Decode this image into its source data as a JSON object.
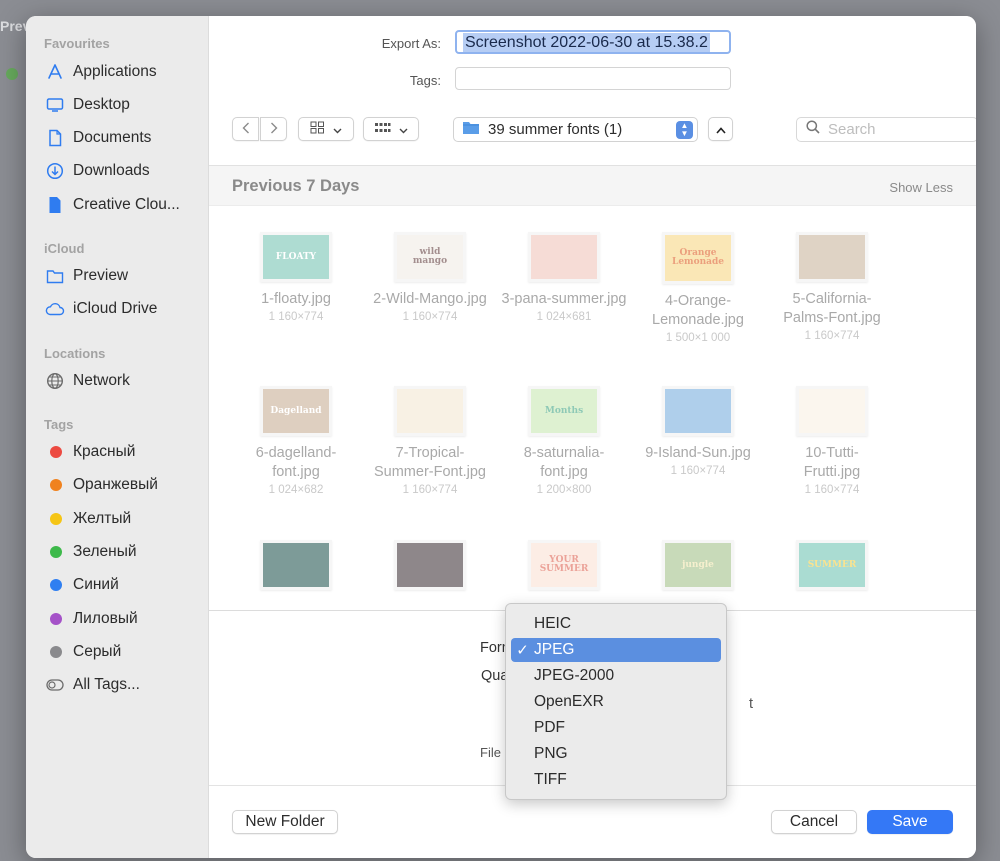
{
  "background": {
    "window_title": "Prev"
  },
  "sidebar": {
    "sections": [
      {
        "heading": "Favourites",
        "items": [
          {
            "label": "Applications",
            "icon": "applications-icon"
          },
          {
            "label": "Desktop",
            "icon": "desktop-icon"
          },
          {
            "label": "Documents",
            "icon": "document-icon"
          },
          {
            "label": "Downloads",
            "icon": "download-icon"
          },
          {
            "label": "Creative Clou...",
            "icon": "file-icon"
          }
        ]
      },
      {
        "heading": "iCloud",
        "items": [
          {
            "label": "Preview",
            "icon": "folder-icon"
          },
          {
            "label": "iCloud Drive",
            "icon": "cloud-icon"
          }
        ]
      },
      {
        "heading": "Locations",
        "items": [
          {
            "label": "Network",
            "icon": "globe-icon"
          }
        ]
      },
      {
        "heading": "Tags",
        "items": [
          {
            "label": "Красный",
            "color": "#ec4a41"
          },
          {
            "label": "Оранжевый",
            "color": "#f0821e"
          },
          {
            "label": "Желтый",
            "color": "#f5c515"
          },
          {
            "label": "Зеленый",
            "color": "#3db94a"
          },
          {
            "label": "Синий",
            "color": "#2f7ff1"
          },
          {
            "label": "Лиловый",
            "color": "#a552c8"
          },
          {
            "label": "Серый",
            "color": "#8a8a8d"
          },
          {
            "label": "All Tags...",
            "icon": "all-tags-icon"
          }
        ]
      }
    ]
  },
  "form": {
    "export_label": "Export As:",
    "export_value": "Screenshot 2022-06-30 at 15.38.2",
    "tags_label": "Tags:",
    "tags_value": ""
  },
  "toolbar": {
    "location": "39 summer fonts (1)",
    "search_placeholder": "Search"
  },
  "browser": {
    "section_title": "Previous 7 Days",
    "show_less": "Show Less",
    "files": [
      {
        "name": "1-floaty.jpg",
        "dims": "1 160×774",
        "bg": "#7ec8b8",
        "fg": "#ffffff",
        "text": "FLOATY"
      },
      {
        "name": "2-Wild-Mango.jpg",
        "dims": "1 160×774",
        "bg": "#f1ece6",
        "fg": "#6b4a4a",
        "text": "wild mango"
      },
      {
        "name": "3-pana-summer.jpg",
        "dims": "1 024×681",
        "bg": "#f2c8bd",
        "fg": "#ffffff",
        "text": ""
      },
      {
        "name": "4-Orange-Lemonade.jpg",
        "dims": "1 500×1 000",
        "bg": "#f7d98a",
        "fg": "#e0662e",
        "text": "Orange Lemonade"
      },
      {
        "name": "5-California-Palms-Font.jpg",
        "dims": "1 160×774",
        "bg": "#cdb9a3",
        "fg": "#5d4a3a",
        "text": ""
      },
      {
        "name": "6-dagelland-font.jpg",
        "dims": "1 024×682",
        "bg": "#cbb29a",
        "fg": "#ffffff",
        "text": "Dagelland"
      },
      {
        "name": "7-Tropical-Summer-Font.jpg",
        "dims": "1 160×774",
        "bg": "#f4e9d4",
        "fg": "#3d8f8f",
        "text": ""
      },
      {
        "name": "8-saturnalia-font.jpg",
        "dims": "1 200×800",
        "bg": "#cbe9b5",
        "fg": "#4aa98a",
        "text": "Months"
      },
      {
        "name": "9-Island-Sun.jpg",
        "dims": "1 160×774",
        "bg": "#7fb3e0",
        "fg": "#f5c04b",
        "text": ""
      },
      {
        "name": "10-Tutti-Frutti.jpg",
        "dims": "1 160×774",
        "bg": "#f9f1e4",
        "fg": "#e38a5c",
        "text": ""
      },
      {
        "name": "",
        "dims": "",
        "bg": "#2f5e5a",
        "fg": "#cfe3df",
        "text": ""
      },
      {
        "name": "",
        "dims": "",
        "bg": "#4a3f44",
        "fg": "#f3c7a7",
        "text": ""
      },
      {
        "name": "",
        "dims": "",
        "bg": "#fbe3d6",
        "fg": "#e06a5a",
        "text": "YOUR SUMMER"
      },
      {
        "name": "",
        "dims": "",
        "bg": "#a7c48f",
        "fg": "#f2e7b1",
        "text": "jungle"
      },
      {
        "name": "",
        "dims": "",
        "bg": "#77c7b7",
        "fg": "#f7d34c",
        "text": "SUMMER"
      }
    ]
  },
  "options": {
    "format_label": "Format",
    "quality_label": "Quality",
    "filesize_label": "File Size",
    "hidden_partial": "t"
  },
  "format_menu": {
    "selected": "JPEG",
    "options": [
      "HEIC",
      "JPEG",
      "JPEG-2000",
      "OpenEXR",
      "PDF",
      "PNG",
      "TIFF"
    ]
  },
  "footer": {
    "new_folder": "New Folder",
    "cancel": "Cancel",
    "save": "Save"
  },
  "colors": {
    "accent": "#3478f6",
    "menu_highlight": "#5b8fe0",
    "sidebar_bg": "#ebebeb"
  }
}
